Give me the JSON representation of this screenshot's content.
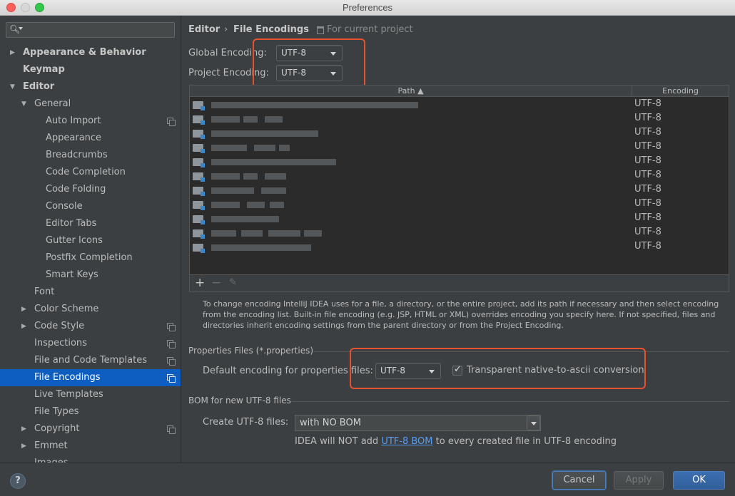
{
  "window": {
    "title": "Preferences"
  },
  "sidebar": {
    "search": {
      "value": "",
      "placeholder": ""
    },
    "items": [
      {
        "label": "Appearance & Behavior",
        "arrow": "▶",
        "bold": true
      },
      {
        "label": "Keymap",
        "bold": true
      },
      {
        "label": "Editor",
        "arrow": "▼",
        "bold": true
      },
      {
        "label": "General",
        "arrow": "▼"
      },
      {
        "label": "Auto Import",
        "copy": true
      },
      {
        "label": "Appearance"
      },
      {
        "label": "Breadcrumbs"
      },
      {
        "label": "Code Completion"
      },
      {
        "label": "Code Folding"
      },
      {
        "label": "Console"
      },
      {
        "label": "Editor Tabs"
      },
      {
        "label": "Gutter Icons"
      },
      {
        "label": "Postfix Completion"
      },
      {
        "label": "Smart Keys"
      },
      {
        "label": "Font"
      },
      {
        "label": "Color Scheme",
        "arrow": "▶"
      },
      {
        "label": "Code Style",
        "arrow": "▶",
        "copy": true
      },
      {
        "label": "Inspections",
        "copy": true
      },
      {
        "label": "File and Code Templates",
        "copy": true
      },
      {
        "label": "File Encodings",
        "copy": true,
        "selected": true
      },
      {
        "label": "Live Templates"
      },
      {
        "label": "File Types"
      },
      {
        "label": "Copyright",
        "arrow": "▶",
        "copy": true
      },
      {
        "label": "Emmet",
        "arrow": "▶"
      },
      {
        "label": "Images"
      }
    ]
  },
  "breadcrumb": {
    "parent": "Editor",
    "separator": "›",
    "current": "File Encodings",
    "scope": "For current project"
  },
  "encodings": {
    "global_label": "Global Encoding:",
    "global_value": "UTF-8",
    "project_label": "Project Encoding:",
    "project_value": "UTF-8"
  },
  "table": {
    "col_path": "Path ▲",
    "col_encoding": "Encoding",
    "rows": [
      "UTF-8",
      "UTF-8",
      "UTF-8",
      "UTF-8",
      "UTF-8",
      "UTF-8",
      "UTF-8",
      "UTF-8",
      "UTF-8",
      "UTF-8",
      "UTF-8"
    ],
    "toolbar": {
      "add": "+",
      "remove": "−",
      "edit": "✎"
    }
  },
  "help_text": "To change encoding IntelliJ IDEA uses for a file, a directory, or the entire project, add its path if necessary and then select encoding from the encoding list. Built-in file encoding (e.g. JSP, HTML or XML) overrides encoding you specify here. If not specified, files and directories inherit encoding settings from the parent directory or from the Project Encoding.",
  "properties": {
    "section_title": "Properties Files (*.properties)",
    "default_label": "Default encoding for properties files:",
    "default_value": "UTF-8",
    "native_label": "Transparent native-to-ascii conversion",
    "native_checked": true
  },
  "bom": {
    "section_title": "BOM for new UTF-8 files",
    "create_label": "Create UTF-8 files:",
    "create_value": "with NO BOM",
    "note_before": "IDEA will NOT add ",
    "note_link": "UTF-8 BOM",
    "note_after": " to every created file in UTF-8 encoding"
  },
  "footer": {
    "help": "?",
    "cancel": "Cancel",
    "apply": "Apply",
    "ok": "OK"
  },
  "colors": {
    "accent": "#0d5ec0",
    "highlight_box": "#e8502e",
    "link": "#589df6"
  }
}
